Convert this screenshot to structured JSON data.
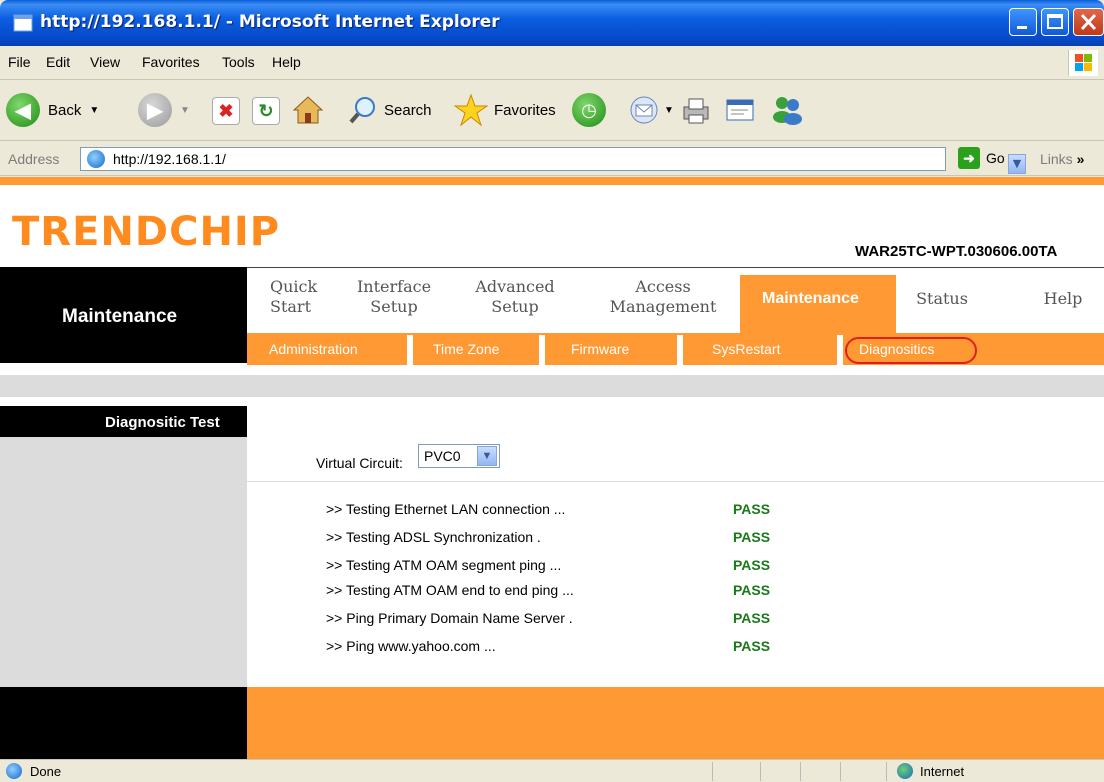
{
  "window": {
    "title": "http://192.168.1.1/ - Microsoft Internet Explorer"
  },
  "menu": {
    "items": [
      "File",
      "Edit",
      "View",
      "Favorites",
      "Tools",
      "Help"
    ]
  },
  "toolbar": {
    "back_label": "Back",
    "search_label": "Search",
    "favorites_label": "Favorites"
  },
  "address": {
    "label": "Address",
    "url": "http://192.168.1.1/",
    "go_label": "Go",
    "links_label": "Links"
  },
  "router": {
    "logo": "TRENDCHIP",
    "model": "WAR25TC-WPT.030606.00TA",
    "section_title": "Maintenance",
    "nav": [
      {
        "line1": "Quick",
        "line2": "Start"
      },
      {
        "line1": "Interface",
        "line2": "Setup"
      },
      {
        "line1": "Advanced",
        "line2": "Setup"
      },
      {
        "line1": "Access",
        "line2": "Management"
      },
      {
        "line1": "Maintenance",
        "line2": ""
      },
      {
        "line1": "Status",
        "line2": ""
      },
      {
        "line1": "Help",
        "line2": ""
      }
    ],
    "subnav": [
      "Administration",
      "Time Zone",
      "Firmware",
      "SysRestart",
      "Diagnositics"
    ],
    "side_title": "Diagnositic Test",
    "vc_label": "Virtual Circuit:",
    "vc_value": "PVC0",
    "tests": [
      {
        "label": ">> Testing Ethernet LAN connection ...",
        "result": "PASS"
      },
      {
        "label": ">> Testing ADSL Synchronization .",
        "result": "PASS"
      },
      {
        "label": ">> Testing ATM OAM segment ping ...",
        "result": "PASS"
      },
      {
        "label": ">> Testing ATM OAM end to end ping ...",
        "result": "PASS"
      },
      {
        "label": ">> Ping Primary Domain Name Server .",
        "result": "PASS"
      },
      {
        "label": ">> Ping www.yahoo.com ...",
        "result": "PASS"
      }
    ]
  },
  "status": {
    "left": "Done",
    "zone": "Internet"
  },
  "colors": {
    "accent": "#ff9933",
    "pass": "#1a7a1a",
    "logo": "#ff8a1d"
  }
}
